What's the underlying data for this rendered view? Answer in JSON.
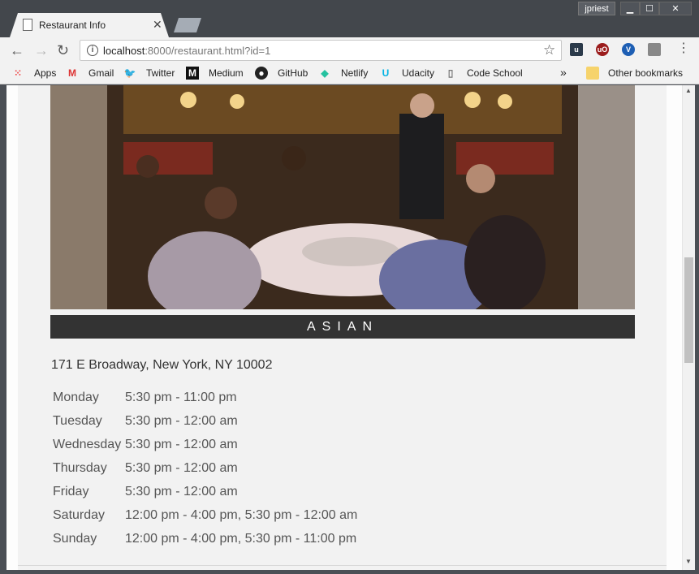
{
  "window": {
    "tab_title": "Restaurant Info",
    "tab_close": "✕",
    "profile": "jpriest",
    "min": "▁",
    "max": "☐",
    "close": "✕"
  },
  "toolbar": {
    "back": "←",
    "forward": "→",
    "reload": "↻",
    "url_host": "localhost",
    "url_rest": ":8000/restaurant.html?id=1",
    "bookmark_star": "☆",
    "menu": "⋮"
  },
  "bookmarks": {
    "items": [
      {
        "label": "Apps",
        "icon": "apps-grid-icon"
      },
      {
        "label": "Gmail",
        "icon": "gmail-icon"
      },
      {
        "label": "Twitter",
        "icon": "twitter-icon"
      },
      {
        "label": "Medium",
        "icon": "medium-icon"
      },
      {
        "label": "GitHub",
        "icon": "github-icon"
      },
      {
        "label": "Netlify",
        "icon": "netlify-icon"
      },
      {
        "label": "Udacity",
        "icon": "udacity-icon"
      },
      {
        "label": "Code School",
        "icon": "page-icon"
      }
    ],
    "overflow": "»",
    "other": "Other bookmarks"
  },
  "restaurant": {
    "cuisine": "ASIAN",
    "address": "171 E Broadway, New York, NY 10002",
    "hours": [
      {
        "day": "Monday",
        "time": "5:30 pm - 11:00 pm"
      },
      {
        "day": "Tuesday",
        "time": "5:30 pm - 12:00 am"
      },
      {
        "day": "Wednesday",
        "time": "5:30 pm - 12:00 am"
      },
      {
        "day": "Thursday",
        "time": "5:30 pm - 12:00 am"
      },
      {
        "day": "Friday",
        "time": "5:30 pm - 12:00 am"
      },
      {
        "day": "Saturday",
        "time": "12:00 pm - 4:00 pm, 5:30 pm - 12:00 am"
      },
      {
        "day": "Sunday",
        "time": "12:00 pm - 4:00 pm, 5:30 pm - 11:00 pm"
      }
    ]
  },
  "colors": {
    "cuisine_bar": "#333333",
    "page_bg": "#f2f2f2",
    "frame": "#43474c"
  }
}
